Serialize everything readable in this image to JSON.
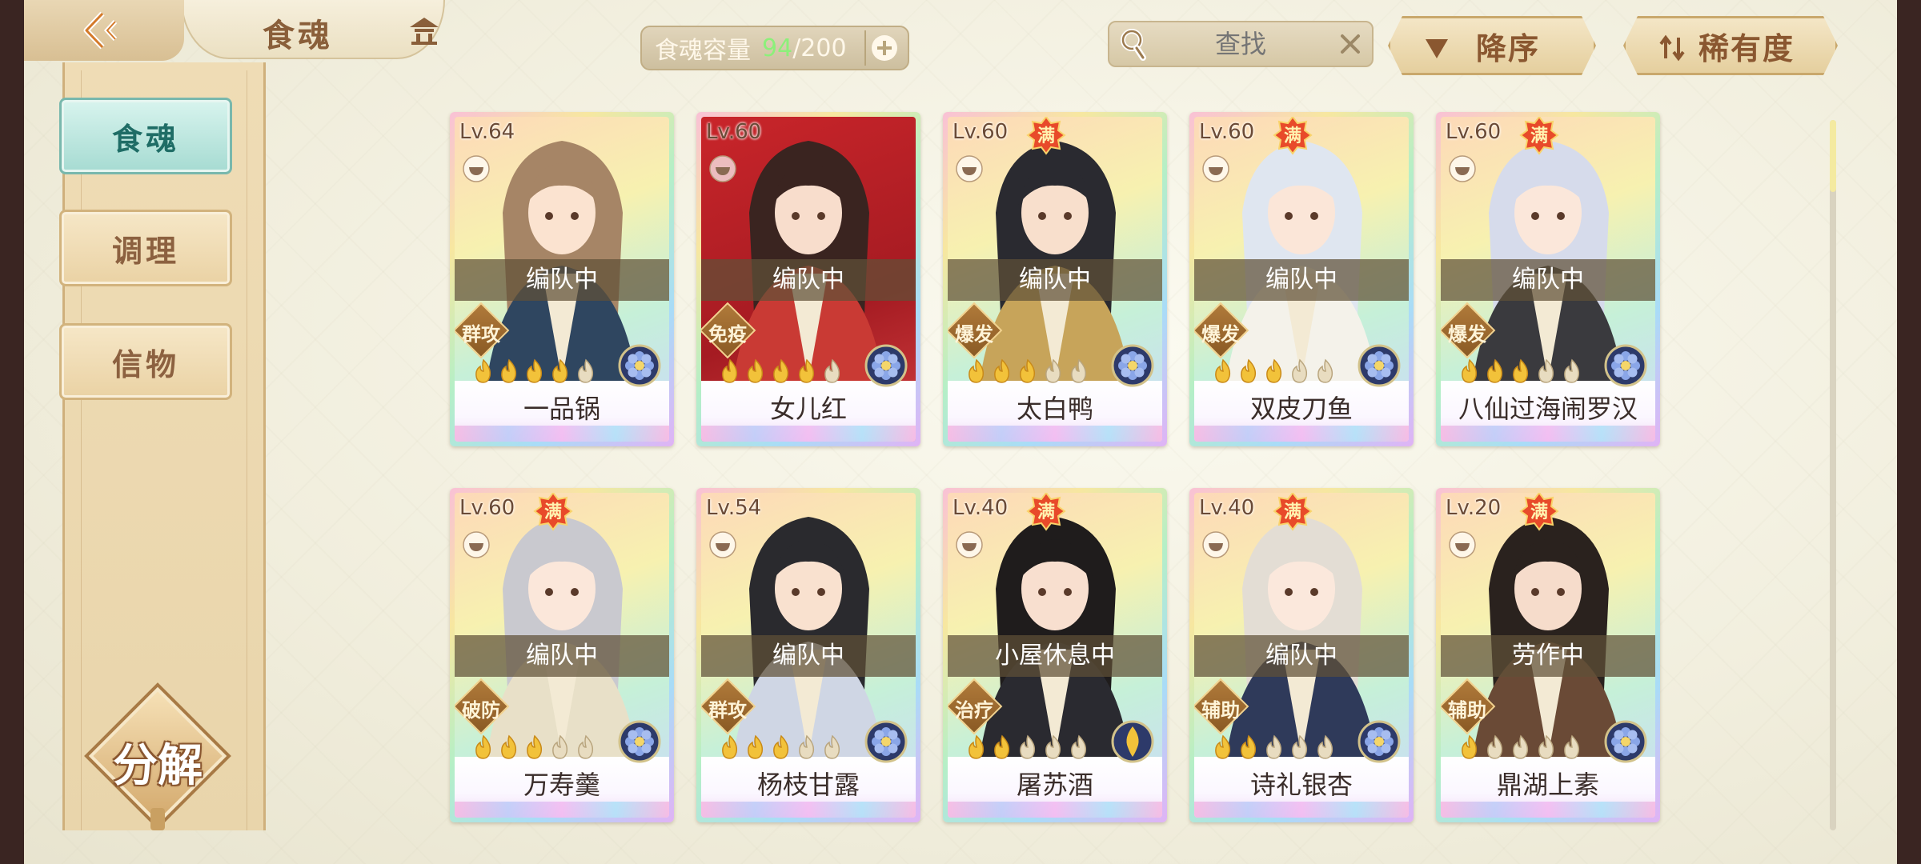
{
  "header": {
    "title": "食魂",
    "capacity_label": "食魂容量",
    "capacity_current": "94",
    "capacity_max": "/200",
    "search_placeholder": "查找",
    "sort_order_label": "降序",
    "sort_field_label": "稀有度"
  },
  "sidebar": {
    "tabs": [
      {
        "label": "食魂",
        "active": true
      },
      {
        "label": "调理",
        "active": false
      },
      {
        "label": "信物",
        "active": false
      }
    ],
    "decompose_label": "分解"
  },
  "max_badge": "满",
  "cards": [
    {
      "level": "Lv.64",
      "name": "一品锅",
      "status": "编队中",
      "role": "群攻",
      "max": false,
      "stars": 4,
      "element": "flower"
    },
    {
      "level": "Lv.60",
      "name": "女儿红",
      "status": "编队中",
      "role": "免疫",
      "max": false,
      "stars": 4,
      "element": "flower"
    },
    {
      "level": "Lv.60",
      "name": "太白鸭",
      "status": "编队中",
      "role": "爆发",
      "max": true,
      "stars": 3,
      "element": "flower"
    },
    {
      "level": "Lv.60",
      "name": "双皮刀鱼",
      "status": "编队中",
      "role": "爆发",
      "max": true,
      "stars": 3,
      "element": "flower"
    },
    {
      "level": "Lv.60",
      "name": "八仙过海闹罗汉",
      "status": "编队中",
      "role": "爆发",
      "max": true,
      "stars": 3,
      "element": "flower"
    },
    {
      "level": "Lv.60",
      "name": "万寿羹",
      "status": "编队中",
      "role": "破防",
      "max": true,
      "stars": 3,
      "element": "flower"
    },
    {
      "level": "Lv.54",
      "name": "杨枝甘露",
      "status": "编队中",
      "role": "群攻",
      "max": false,
      "stars": 3,
      "element": "flower"
    },
    {
      "level": "Lv.40",
      "name": "屠苏酒",
      "status": "小屋休息中",
      "role": "治疗",
      "max": true,
      "stars": 2,
      "element": "flame"
    },
    {
      "level": "Lv.40",
      "name": "诗礼银杏",
      "status": "编队中",
      "role": "辅助",
      "max": true,
      "stars": 2,
      "element": "flower"
    },
    {
      "level": "Lv.20",
      "name": "鼎湖上素",
      "status": "劳作中",
      "role": "辅助",
      "max": true,
      "stars": 1,
      "element": "flower"
    }
  ],
  "colors": {
    "accent_green": "#8cf07a",
    "active_tab": "#a6dbd2",
    "status_band": "#5f5037",
    "role_tag": "#8a5a24"
  }
}
